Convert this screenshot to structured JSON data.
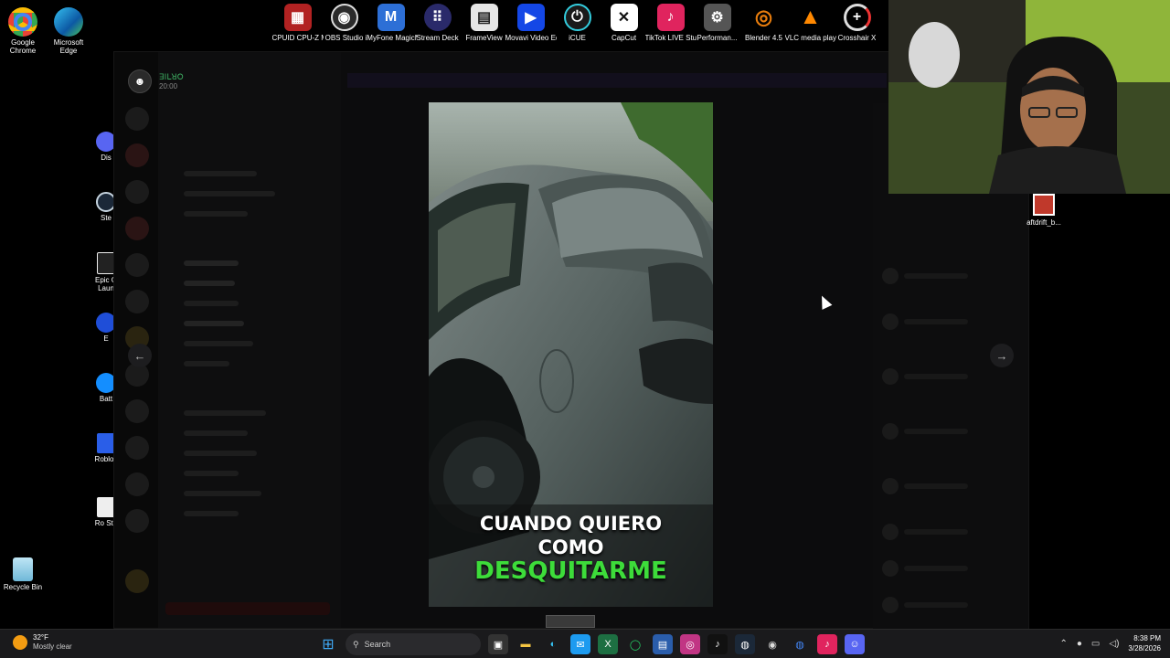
{
  "desktop_top": [
    {
      "label": "CPUID CPU-Z MSI",
      "icon": "cpuz-icon",
      "color": "#b22222"
    },
    {
      "label": "OBS Studio",
      "icon": "obs-icon",
      "color": "#2b2b2b"
    },
    {
      "label": "iMyFone MagicMic",
      "icon": "magicmic-icon",
      "color": "#2d6fd6"
    },
    {
      "label": "Stream Deck",
      "icon": "streamdeck-icon",
      "color": "#2a2a6a"
    },
    {
      "label": "FrameView",
      "icon": "frameview-icon",
      "color": "#e6e6e6"
    },
    {
      "label": "Movavi Video Editor 25",
      "icon": "movavi-icon",
      "color": "#1447e6"
    },
    {
      "label": "iCUE",
      "icon": "icue-icon",
      "color": "#1a1a1a"
    },
    {
      "label": "CapCut",
      "icon": "capcut-icon",
      "color": "#111111"
    },
    {
      "label": "TikTok LIVE Studio",
      "icon": "tiktok-live-icon",
      "color": "#e0245e"
    },
    {
      "label": "Performan...",
      "icon": "performance-icon",
      "color": "#444444"
    },
    {
      "label": "Blender 4.5",
      "icon": "blender-icon",
      "color": "#e87d0d"
    },
    {
      "label": "VLC media player",
      "icon": "vlc-icon",
      "color": "#ff8800"
    },
    {
      "label": "Crosshair X",
      "icon": "crosshair-icon",
      "color": "#222222"
    }
  ],
  "desktop_left": [
    {
      "label": "Google Chrome",
      "icon": "chrome-icon"
    },
    {
      "label": "Microsoft Edge",
      "icon": "edge-icon"
    },
    {
      "label": "Dis",
      "icon": "discord-icon"
    },
    {
      "label": "Ste",
      "icon": "steam-icon"
    },
    {
      "label": "Epic G Laun",
      "icon": "epic-icon"
    },
    {
      "label": "E",
      "icon": "ea-icon"
    },
    {
      "label": "Batt",
      "icon": "battlenet-icon"
    },
    {
      "label": "Roblox",
      "icon": "roblox-icon"
    },
    {
      "label": "Ro Stu",
      "icon": "roblox-studio-icon"
    },
    {
      "label": "Recycle Bin",
      "icon": "recycle-bin-icon"
    }
  ],
  "right_file": {
    "label": "aftdrift_b..."
  },
  "viewer": {
    "username": "ꓱꓲꓡꓤꓳ",
    "time": "20:00"
  },
  "video": {
    "caption_line1": "CUANDO QUIERO",
    "caption_line2": "COMO",
    "caption_line3": "DESQUITARME",
    "caption_highlight_color": "#3ddc3a"
  },
  "taskbar": {
    "weather_temp": "32°F",
    "weather_desc": "Mostly clear",
    "search_placeholder": "Search",
    "time": "8:38 PM",
    "date": "3/28/2026"
  }
}
